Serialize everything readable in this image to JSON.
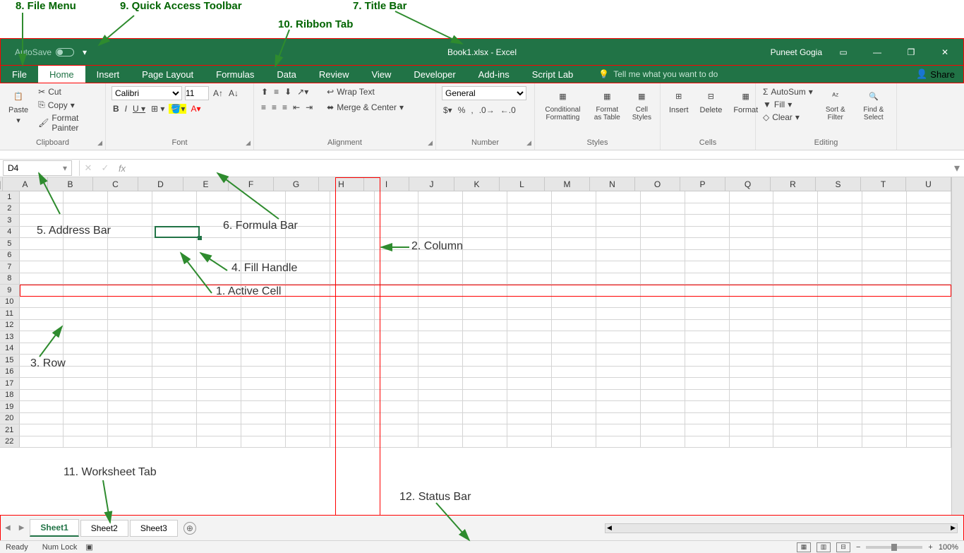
{
  "annotations": {
    "a1": "1. Active Cell",
    "a2": "2. Column",
    "a3": "3. Row",
    "a4": "4. Fill Handle",
    "a5": "5. Address Bar",
    "a6": "6. Formula Bar",
    "a7": "7. Title Bar",
    "a8": "8. File Menu",
    "a9": "9. Quick Access Toolbar",
    "a10": "10. Ribbon Tab",
    "a11": "11. Worksheet Tab",
    "a12": "12. Status Bar"
  },
  "titlebar": {
    "autosave": "AutoSave",
    "autosave_state": "Off",
    "title": "Book1.xlsx - Excel",
    "user": "Puneet Gogia"
  },
  "tabs": [
    "File",
    "Home",
    "Insert",
    "Page Layout",
    "Formulas",
    "Data",
    "Review",
    "View",
    "Developer",
    "Add-ins",
    "Script Lab"
  ],
  "tellme": "Tell me what you want to do",
  "share": "Share",
  "ribbon": {
    "clipboard": {
      "paste": "Paste",
      "cut": "Cut",
      "copy": "Copy",
      "fp": "Format Painter",
      "label": "Clipboard"
    },
    "font": {
      "name": "Calibri",
      "size": "11",
      "label": "Font"
    },
    "alignment": {
      "wrap": "Wrap Text",
      "merge": "Merge & Center",
      "label": "Alignment"
    },
    "number": {
      "general": "General",
      "label": "Number"
    },
    "styles": {
      "cf": "Conditional Formatting",
      "fat": "Format as Table",
      "cs": "Cell Styles",
      "label": "Styles"
    },
    "cells": {
      "insert": "Insert",
      "delete": "Delete",
      "format": "Format",
      "label": "Cells"
    },
    "editing": {
      "autosum": "AutoSum",
      "fill": "Fill",
      "clear": "Clear",
      "sort": "Sort & Filter",
      "find": "Find & Select",
      "label": "Editing"
    }
  },
  "namebox": "D4",
  "columns": [
    "A",
    "B",
    "C",
    "D",
    "E",
    "F",
    "G",
    "H",
    "I",
    "J",
    "K",
    "L",
    "M",
    "N",
    "O",
    "P",
    "Q",
    "R",
    "S",
    "T",
    "U"
  ],
  "rows": 22,
  "sheets": [
    "Sheet1",
    "Sheet2",
    "Sheet3"
  ],
  "status": {
    "ready": "Ready",
    "numlock": "Num Lock",
    "zoom": "100%"
  }
}
